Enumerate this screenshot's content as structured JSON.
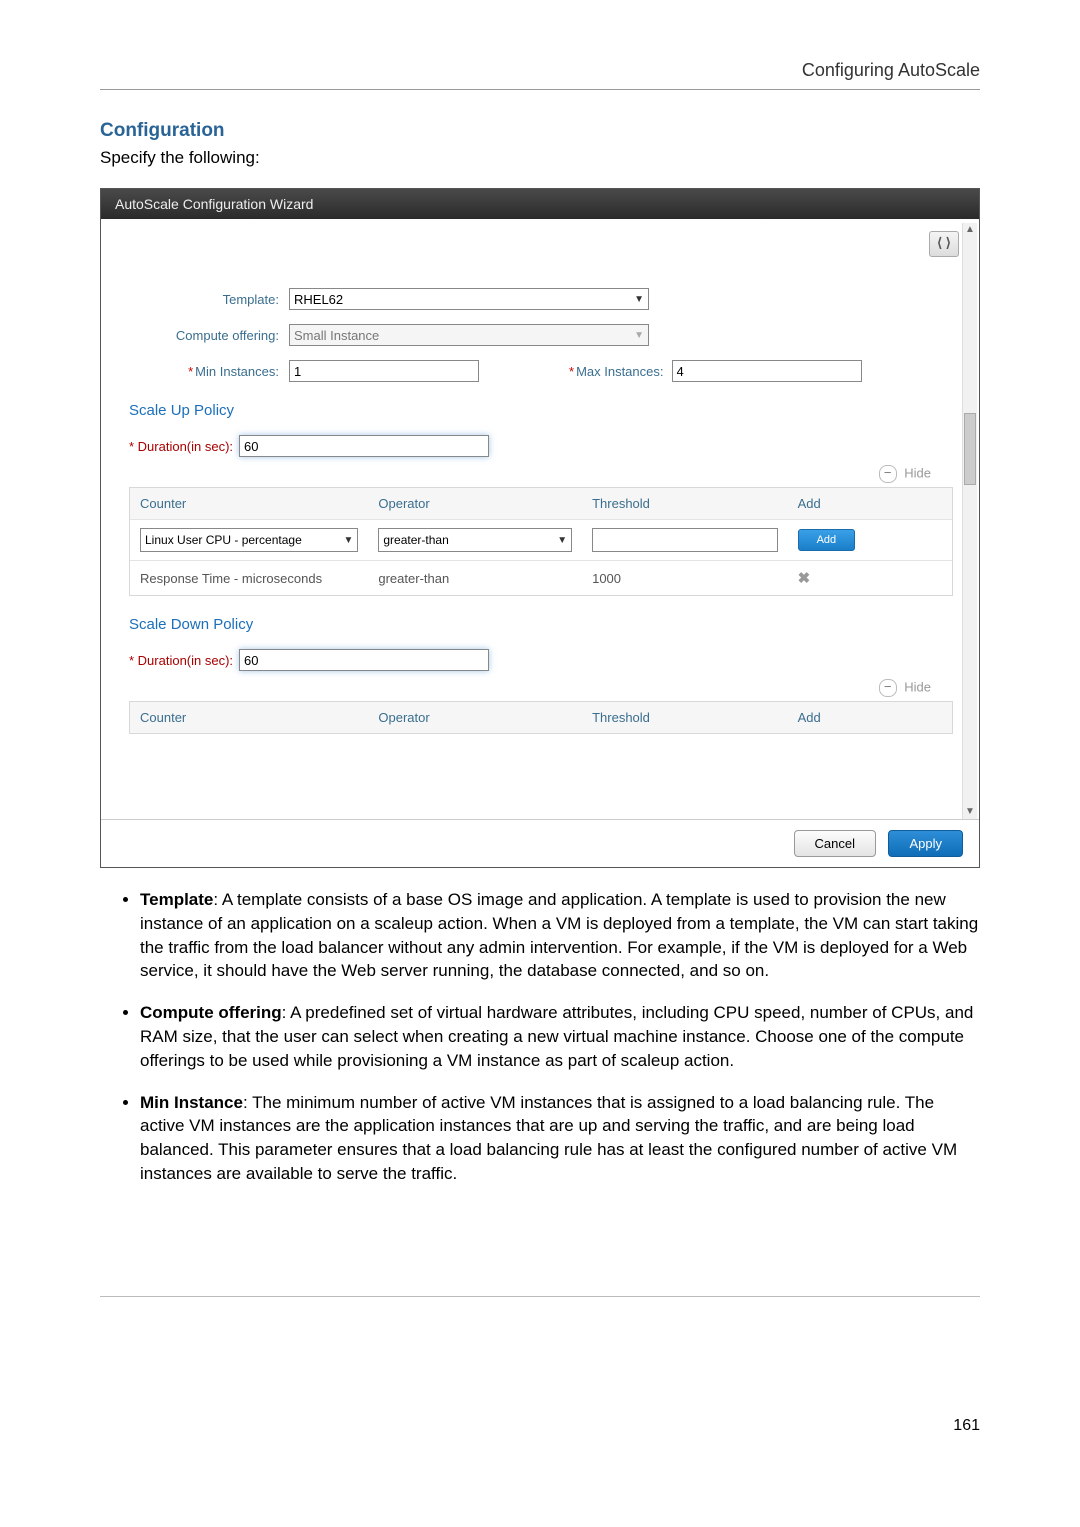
{
  "header": {
    "breadcrumb": "Configuring AutoScale"
  },
  "section": {
    "title": "Configuration",
    "subtitle": "Specify the following:"
  },
  "wizard": {
    "title": "AutoScale Configuration Wizard",
    "close_icon_label": "⟨ ⟩",
    "fields": {
      "template_label": "Template:",
      "template_value": "RHEL62",
      "compute_label": "Compute offering:",
      "compute_value": "Small Instance",
      "min_label": "Min Instances:",
      "min_value": "1",
      "max_label": "Max Instances:",
      "max_value": "4"
    },
    "scale_up": {
      "title": "Scale Up Policy",
      "duration_label": "* Duration(in sec):",
      "duration_value": "60",
      "hide": "Hide",
      "headers": {
        "counter": "Counter",
        "operator": "Operator",
        "threshold": "Threshold",
        "add": "Add"
      },
      "new_row": {
        "counter": "Linux User CPU - percentage",
        "operator": "greater-than",
        "threshold": "",
        "add_button": "Add"
      },
      "rows": [
        {
          "counter": "Response Time - microseconds",
          "operator": "greater-than",
          "threshold": "1000",
          "delete_icon": "✖"
        }
      ]
    },
    "scale_down": {
      "title": "Scale Down Policy",
      "duration_label": "* Duration(in sec):",
      "duration_value": "60",
      "hide": "Hide",
      "headers": {
        "counter": "Counter",
        "operator": "Operator",
        "threshold": "Threshold",
        "add": "Add"
      }
    },
    "footer": {
      "cancel": "Cancel",
      "apply": "Apply"
    }
  },
  "bullets": {
    "template": {
      "label": "Template",
      "text": ": A template consists of a base OS image and application. A template is used to provision the new instance of an application on a scaleup action. When a VM is deployed from a template, the VM can start taking the traffic from the load balancer without any admin intervention. For example, if the VM is deployed for a Web service, it should have the Web server running, the database connected, and so on."
    },
    "compute": {
      "label": "Compute offering",
      "text": ": A predefined set of virtual hardware attributes, including CPU speed, number of CPUs, and RAM size, that the user can select when creating a new virtual machine instance. Choose one of the compute offerings to be used while provisioning a VM instance as part of scaleup action."
    },
    "min": {
      "label": "Min Instance",
      "text": ": The minimum number of active VM instances that is assigned to a load balancing rule. The active VM instances are the application instances that are up and serving the traffic, and are being load balanced. This parameter ensures that a load balancing rule has at least the configured number of active VM instances are available to serve the traffic."
    }
  },
  "page_number": "161"
}
